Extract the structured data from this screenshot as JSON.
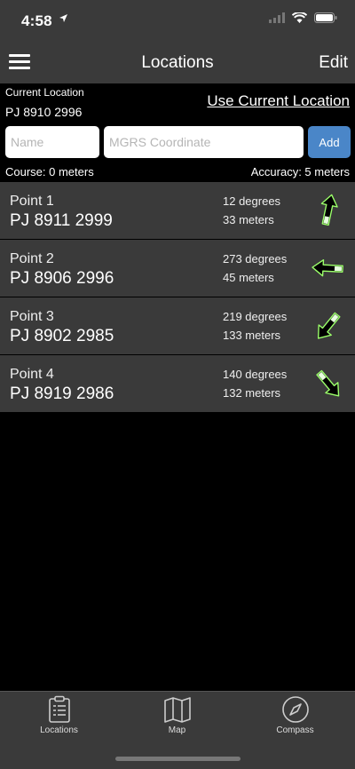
{
  "status": {
    "time": "4:58"
  },
  "nav": {
    "title": "Locations",
    "edit_label": "Edit"
  },
  "current": {
    "label": "Current Location",
    "value": "PJ 8910 2996",
    "use_current_label": "Use Current Location"
  },
  "form": {
    "name_placeholder": "Name",
    "coord_placeholder": "MGRS Coordinate",
    "add_label": "Add"
  },
  "info": {
    "course": "Course: 0 meters",
    "accuracy": "Accuracy: 5 meters"
  },
  "points": [
    {
      "name": "Point 1",
      "coord": "PJ 8911 2999",
      "degrees_text": "12 degrees",
      "distance": "33 meters",
      "bearing": 12
    },
    {
      "name": "Point 2",
      "coord": "PJ 8906 2996",
      "degrees_text": "273 degrees",
      "distance": "45 meters",
      "bearing": 273
    },
    {
      "name": "Point 3",
      "coord": "PJ 8902 2985",
      "degrees_text": "219 degrees",
      "distance": "133 meters",
      "bearing": 219
    },
    {
      "name": "Point 4",
      "coord": "PJ 8919 2986",
      "degrees_text": "140 degrees",
      "distance": "132 meters",
      "bearing": 140
    }
  ],
  "tabs": [
    {
      "label": "Locations",
      "icon": "clipboard-icon"
    },
    {
      "label": "Map",
      "icon": "map-icon"
    },
    {
      "label": "Compass",
      "icon": "compass-icon"
    }
  ],
  "colors": {
    "bar": "#3a3a3a",
    "accent": "#4a86c8",
    "arrow_glow": "#9bff6a"
  }
}
